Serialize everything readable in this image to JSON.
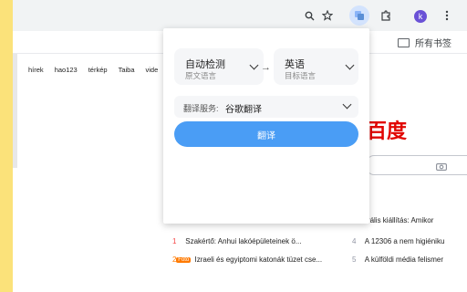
{
  "toolbar": {
    "icons": [
      "zoom-icon",
      "bookmark-star-icon",
      "translate-extension-icon",
      "extensions-puzzle-icon",
      "profile-avatar",
      "more-menu-icon"
    ],
    "avatar_letter": "k"
  },
  "bookmarks_bar": {
    "all_bookmarks_label": "所有书签"
  },
  "page": {
    "nav_links": [
      "hírek",
      "hao123",
      "térkép",
      "Taiba",
      "vide"
    ],
    "logo_text": "百度",
    "news": [
      {
        "num": "1",
        "text": "Szakértő: Anhui lakóépületeinek ö...",
        "color": "red"
      },
      {
        "num": "2",
        "badge": "Fotó",
        "text": "Izraeli és egyiptomi katonák tüzet cse...",
        "color": "orange"
      },
      {
        "num": "4",
        "text": "A 12306 a nem higiéniku",
        "color": "grey"
      },
      {
        "num": "5",
        "text": "A külföldi média felismer",
        "color": "grey"
      },
      {
        "num": "",
        "text": "kulturális kiállítás: Amikor",
        "color": "orange"
      }
    ]
  },
  "popup": {
    "source_lang": {
      "name": "自动检测",
      "sub": "原文语言"
    },
    "target_lang": {
      "name": "英语",
      "sub": "目标语言"
    },
    "service_label": "翻译服务:",
    "service_value": "谷歌翻译",
    "translate_button": "翻译"
  },
  "colors": {
    "accent": "#4a9df5",
    "background": "#fbe27a",
    "logo": "#e10602"
  }
}
